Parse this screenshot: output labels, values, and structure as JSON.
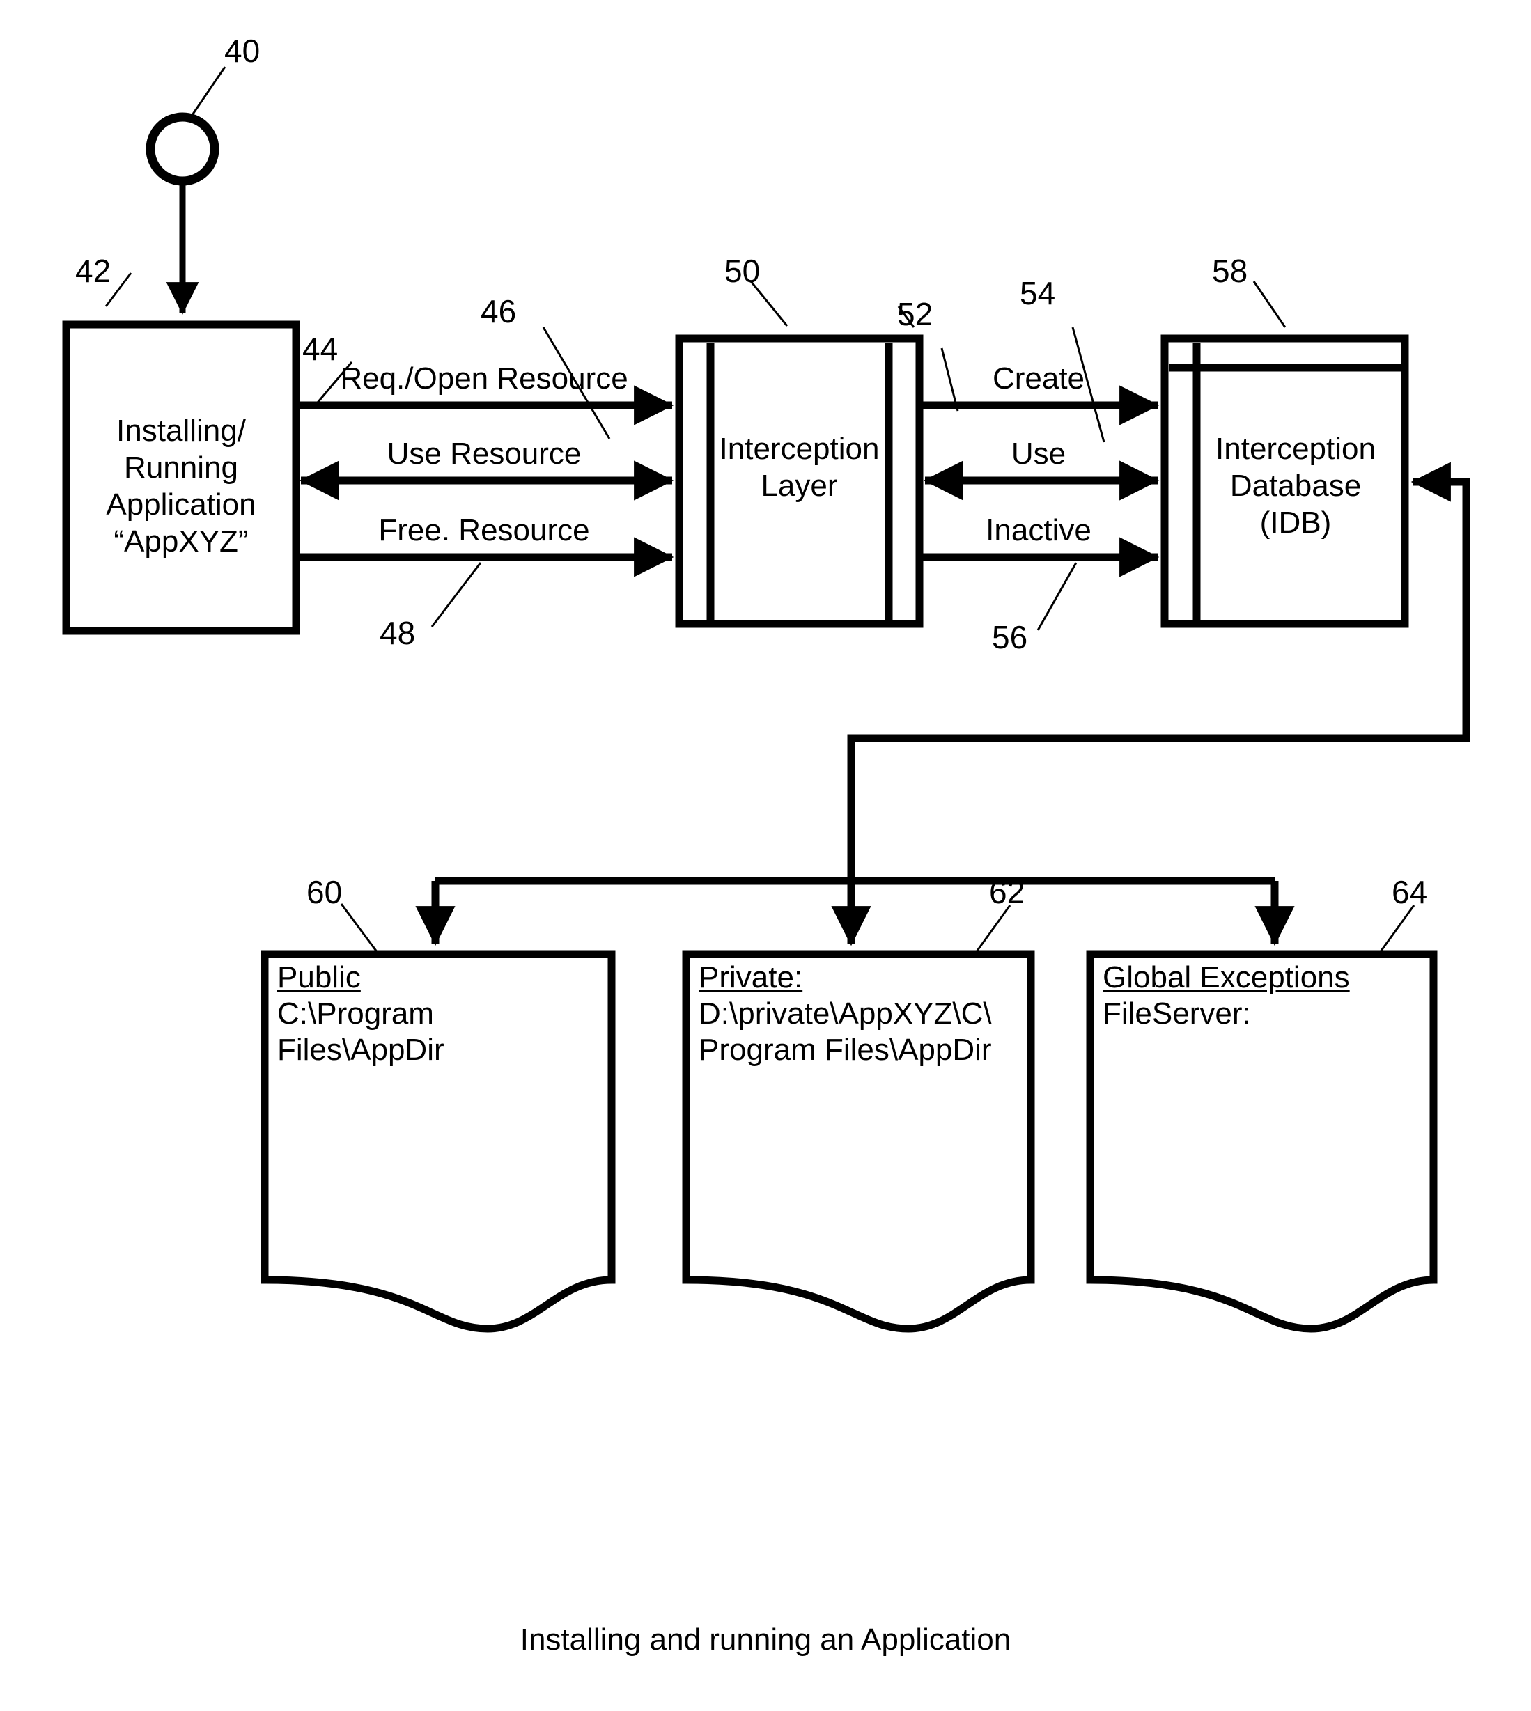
{
  "figure": {
    "caption": "Installing and running an Application"
  },
  "nodes": {
    "start": {
      "ref": "40",
      "shape": "circle"
    },
    "application": {
      "ref": "42",
      "label": "Installing/\nRunning\nApplication\n“AppXYZ”"
    },
    "interception_layer": {
      "ref": "50",
      "label": "Interception\nLayer"
    },
    "interception_database": {
      "ref": "58",
      "label": "Interception\nDatabase\n(IDB)"
    }
  },
  "edges": {
    "req_open_resource": {
      "ref_left": "44",
      "ref_right": "46",
      "label": "Req./Open Resource",
      "direction": "right"
    },
    "use_resource": {
      "label": "Use Resource",
      "direction": "both"
    },
    "free_resource": {
      "ref": "48",
      "label": "Free. Resource",
      "direction": "right"
    },
    "create": {
      "ref_left": "52",
      "ref_right": "54",
      "label": "Create",
      "direction": "right"
    },
    "use": {
      "label": "Use",
      "direction": "both"
    },
    "inactive": {
      "ref": "56",
      "label": "Inactive",
      "direction": "right"
    }
  },
  "documents": [
    {
      "ref": "60",
      "title": "Public",
      "body": "C:\\Program Files\\AppDir"
    },
    {
      "ref": "62",
      "title": "Private:",
      "body": "D:\\private\\AppXYZ\\C\\\nProgram Files\\AppDir"
    },
    {
      "ref": "64",
      "title": "Global Exceptions",
      "body": "FileServer:"
    }
  ],
  "colors": {
    "stroke": "#000000",
    "background": "#ffffff"
  }
}
